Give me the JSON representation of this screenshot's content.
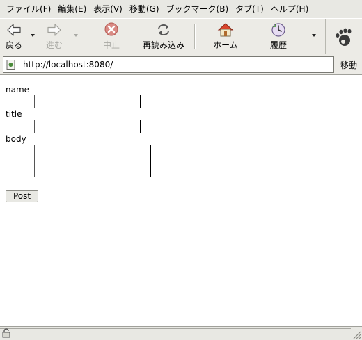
{
  "menubar": {
    "items": [
      {
        "label": "ファイル(",
        "mnemonic": "F",
        "end": ")"
      },
      {
        "label": "編集(",
        "mnemonic": "E",
        "end": ")"
      },
      {
        "label": "表示(",
        "mnemonic": "V",
        "end": ")"
      },
      {
        "label": "移動(",
        "mnemonic": "G",
        "end": ")"
      },
      {
        "label": "ブックマーク(",
        "mnemonic": "B",
        "end": ")"
      },
      {
        "label": "タブ(",
        "mnemonic": "T",
        "end": ")"
      },
      {
        "label": "ヘルプ(",
        "mnemonic": "H",
        "end": ")"
      }
    ]
  },
  "toolbar": {
    "back_label": "戻る",
    "forward_label": "進む",
    "stop_label": "中止",
    "reload_label": "再読み込み",
    "home_label": "ホーム",
    "history_label": "履歴"
  },
  "location": {
    "url": "http://localhost:8080/",
    "go_label": "移動"
  },
  "form": {
    "name_label": "name",
    "name_value": "",
    "title_label": "title",
    "title_value": "",
    "body_label": "body",
    "body_value": "",
    "submit_label": "Post"
  },
  "colors": {
    "chrome": "#ecebe6",
    "reload_accent": "#2d6b2a",
    "stop_accent": "#c0392b"
  }
}
